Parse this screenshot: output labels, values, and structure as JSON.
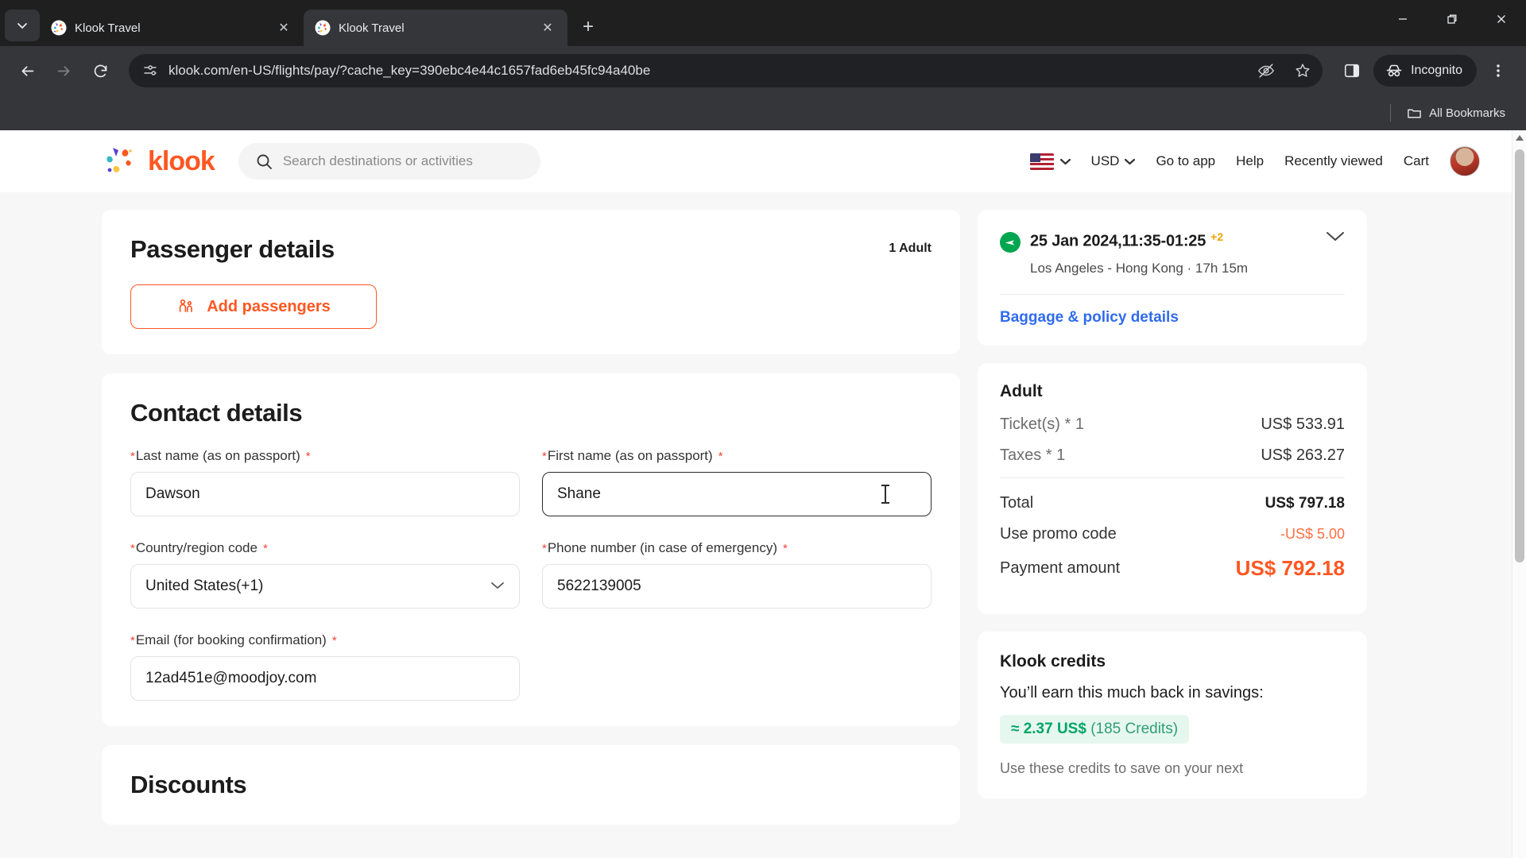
{
  "browser": {
    "tabs": [
      {
        "title": "Klook Travel",
        "active": false
      },
      {
        "title": "Klook Travel",
        "active": true
      }
    ],
    "new_tab_label": "+",
    "close_label": "✕",
    "url": "klook.com/en-US/flights/pay/?cache_key=390ebc4e44c1657fad6eb45fc94a40be",
    "profile_label": "Incognito",
    "bookmarks_label": "All Bookmarks",
    "window": {
      "minimize": "—",
      "maximize": "❐",
      "close": "✕"
    },
    "icons": {
      "tab_list": "tab-list-icon",
      "back": "back-arrow-icon",
      "forward": "forward-arrow-icon",
      "reload": "reload-icon",
      "site_settings": "page-info-icon",
      "tracking": "eye-off-icon",
      "bookmark": "star-icon",
      "side_panel": "side-panel-icon",
      "incognito": "incognito-icon",
      "menu": "three-dot-menu-icon",
      "folder": "folder-icon"
    }
  },
  "site_header": {
    "brand": "klook",
    "search_placeholder": "Search destinations or activities",
    "language_flag": "us-flag",
    "currency": "USD",
    "links": [
      "Go to app",
      "Help",
      "Recently viewed",
      "Cart"
    ]
  },
  "passenger": {
    "title": "Passenger details",
    "count": "1 Adult",
    "add_button": "Add passengers"
  },
  "contact": {
    "title": "Contact details",
    "fields": [
      {
        "label": "Last name (as on passport)",
        "value": "Dawson",
        "required": true,
        "type": "text",
        "focused": false
      },
      {
        "label": "First name (as on passport)",
        "value": "Shane",
        "required": true,
        "type": "text",
        "focused": true
      },
      {
        "label": "Country/region code",
        "value": "United States(+1)",
        "required": true,
        "type": "select",
        "focused": false
      },
      {
        "label": "Phone number (in case of emergency)",
        "value": "5622139005",
        "required": true,
        "type": "text",
        "focused": false
      },
      {
        "label": "Email (for booking confirmation)",
        "value": "12ad451e@moodjoy.com",
        "required": true,
        "type": "text",
        "focused": false
      }
    ]
  },
  "discounts": {
    "title": "Discounts"
  },
  "flight": {
    "datetime": "25 Jan 2024,11:35-01:25",
    "day_offset": "+2",
    "route": "Los Angeles - Hong Kong · 17h 15m",
    "policy_link": "Baggage & policy details"
  },
  "price": {
    "title": "Adult",
    "rows": [
      {
        "label": "Ticket(s) * 1",
        "value": "US$ 533.91"
      },
      {
        "label": "Taxes * 1",
        "value": "US$ 263.27"
      }
    ],
    "total_label": "Total",
    "total_value": "US$ 797.18",
    "promo_label": "Use promo code",
    "promo_value": "-US$ 5.00",
    "pay_label": "Payment amount",
    "pay_value": "US$ 792.18"
  },
  "credits": {
    "title": "Klook credits",
    "subtitle": "You’ll earn this much back in savings:",
    "badge_amount": "≈ 2.37 US$",
    "badge_credits": "(185 Credits)",
    "note": "Use these credits to save on your next"
  },
  "colors": {
    "brand_orange": "#ff5722",
    "link_blue": "#2f6bf0",
    "credit_green": "#00a567",
    "required_red": "#f44336",
    "chrome_dark": "#35363a"
  }
}
